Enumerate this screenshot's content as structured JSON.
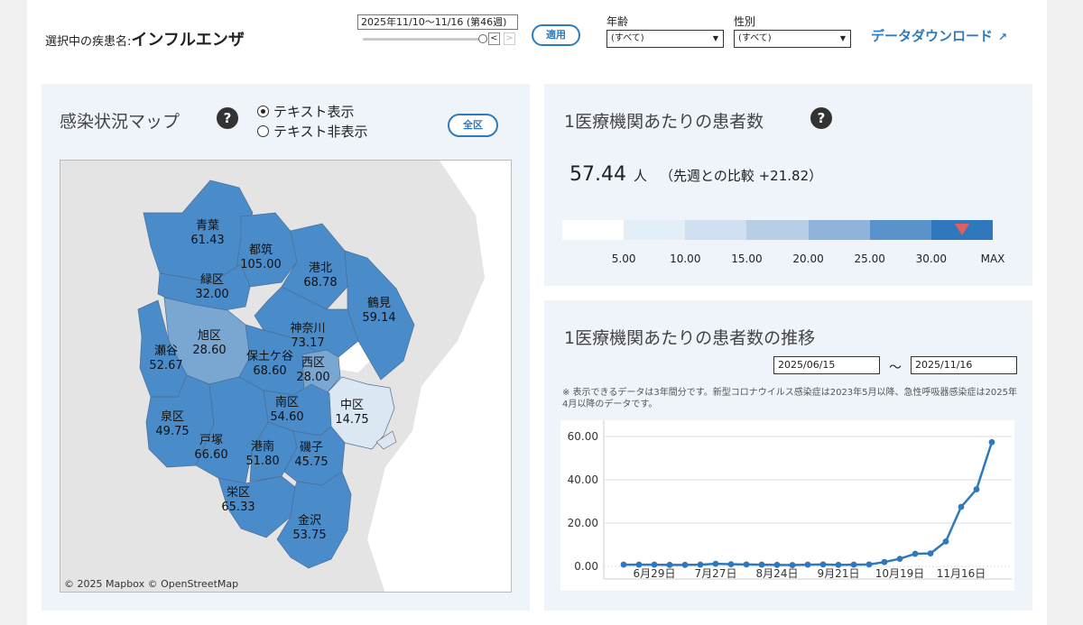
{
  "header": {
    "disease_label": "選択中の疾患名:",
    "disease_name": "インフルエンザ",
    "period": "2025年11/10〜11/16 (第46週)",
    "prev_icon": "chevron-left-icon",
    "next_icon": "chevron-right-icon",
    "prev_label": "<",
    "next_label": ">",
    "apply_label": "適用",
    "age_label": "年齢",
    "age_value": "(すべて)",
    "sex_label": "性別",
    "sex_value": "(すべて)",
    "download_label": "データダウンロード",
    "download_icon": "external-link-icon"
  },
  "map_panel": {
    "title": "感染状況マップ",
    "help": "?",
    "radio_show": "テキスト表示",
    "radio_hide": "テキスト非表示",
    "selected_radio": "テキスト表示",
    "all_button": "全区",
    "attribution": "© 2025 Mapbox  © OpenStreetMap",
    "wards": [
      {
        "name": "青葉",
        "value": "61.43",
        "color": "#4a8bc9"
      },
      {
        "name": "都筑",
        "value": "105.00",
        "color": "#4a8bc9"
      },
      {
        "name": "港北",
        "value": "68.78",
        "color": "#4a8bc9"
      },
      {
        "name": "緑区",
        "value": "32.00",
        "color": "#4a8bc9"
      },
      {
        "name": "鶴見",
        "value": "59.14",
        "color": "#4a8bc9"
      },
      {
        "name": "旭区",
        "value": "28.60",
        "color": "#7aa7d2"
      },
      {
        "name": "神奈川",
        "value": "73.17",
        "color": "#4a8bc9"
      },
      {
        "name": "瀬谷",
        "value": "52.67",
        "color": "#4a8bc9"
      },
      {
        "name": "保土ケ谷",
        "value": "68.60",
        "color": "#4a8bc9"
      },
      {
        "name": "西区",
        "value": "28.00",
        "color": "#7aa7d2"
      },
      {
        "name": "中区",
        "value": "14.75",
        "color": "#dce7f4"
      },
      {
        "name": "南区",
        "value": "54.60",
        "color": "#4a8bc9"
      },
      {
        "name": "泉区",
        "value": "49.75",
        "color": "#4a8bc9"
      },
      {
        "name": "戸塚",
        "value": "66.60",
        "color": "#4a8bc9"
      },
      {
        "name": "港南",
        "value": "51.80",
        "color": "#4a8bc9"
      },
      {
        "name": "磯子",
        "value": "45.75",
        "color": "#4a8bc9"
      },
      {
        "name": "栄区",
        "value": "65.33",
        "color": "#4a8bc9"
      },
      {
        "name": "金沢",
        "value": "53.75",
        "color": "#4a8bc9"
      }
    ]
  },
  "per_facility": {
    "title": "1医療機関あたりの患者数",
    "help": "?",
    "value": "57.44",
    "unit": "人",
    "comparison": "（先週との比較 +21.82）",
    "scale_colors": [
      "#ffffff",
      "#e4eef7",
      "#cfdfef",
      "#b7cfe6",
      "#8fb3da",
      "#5a93cc",
      "#2f78bc"
    ],
    "scale_labels": [
      "5.00",
      "10.00",
      "15.00",
      "20.00",
      "25.00",
      "30.00",
      "MAX"
    ],
    "marker_segment": 6,
    "marker_color": "#e06060"
  },
  "trend": {
    "title": "1医療機関あたりの患者数の推移",
    "start_date": "2025/06/15",
    "end_date": "2025/11/16",
    "tilde": "〜",
    "note": "※ 表示できるデータは3年間分です。新型コロナウイルス感染症は2023年5月以降、急性呼吸器感染症は2025年4月以降のデータです。"
  },
  "chart_data": {
    "type": "line",
    "title": "",
    "xlabel": "",
    "ylabel": "",
    "ylim": [
      0,
      60
    ],
    "yticks": [
      "0.00",
      "20.00",
      "40.00",
      "60.00"
    ],
    "xticks": [
      "6月29日",
      "7月27日",
      "8月24日",
      "9月21日",
      "10月19日",
      "11月16日"
    ],
    "xtick_index": [
      2,
      6,
      10,
      14,
      18,
      22
    ],
    "grid": true,
    "series": [
      {
        "color": "#2f78bc",
        "values": [
          0.8,
          0.8,
          0.8,
          0.7,
          0.7,
          0.8,
          1.2,
          1.0,
          0.9,
          0.8,
          0.7,
          0.6,
          0.8,
          0.9,
          0.7,
          0.8,
          0.9,
          2.0,
          3.5,
          5.8,
          6.0,
          11.5,
          27.5,
          35.6,
          57.4
        ]
      }
    ]
  }
}
